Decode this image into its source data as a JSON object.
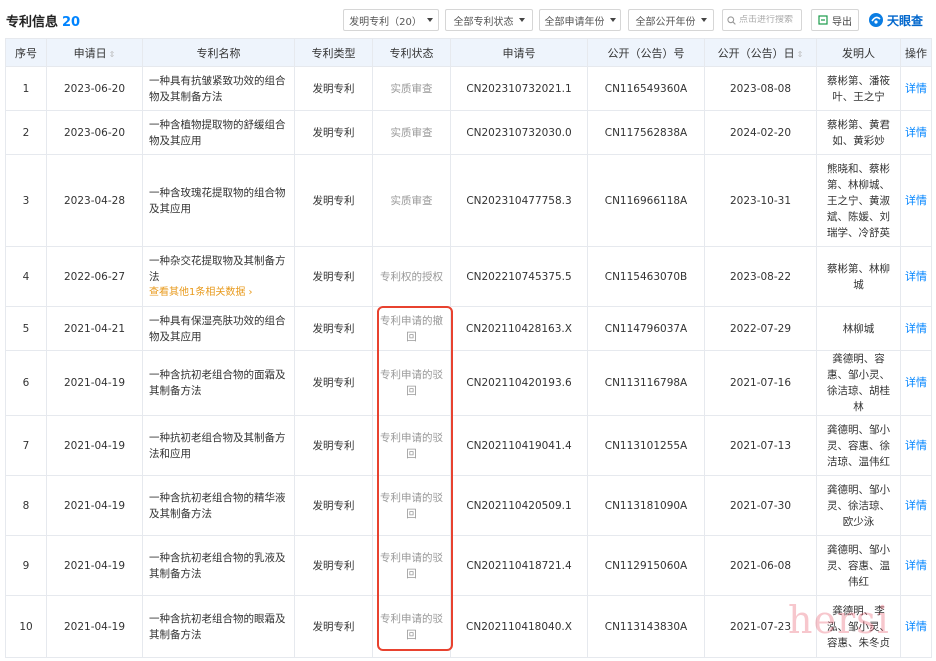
{
  "header": {
    "title": "专利信息",
    "count": "20",
    "filters": [
      {
        "label": "发明专利（20）"
      },
      {
        "label": "全部专利状态"
      },
      {
        "label": "全部申请年份"
      },
      {
        "label": "全部公开年份"
      }
    ],
    "search_placeholder": "点击进行搜索",
    "export_label": "导出",
    "logo_text": "天眼查"
  },
  "table": {
    "columns": [
      "序号",
      "申请日",
      "专利名称",
      "专利类型",
      "专利状态",
      "申请号",
      "公开（公告）号",
      "公开（公告）日",
      "发明人",
      "操作"
    ],
    "sortable": [
      "申请日",
      "公开（公告）日"
    ],
    "rows": [
      {
        "no": "1",
        "date": "2023-06-20",
        "name": "一种具有抗皱紧致功效的组合物及其制备方法",
        "more": "",
        "type": "发明专利",
        "status": "实质审查",
        "app_no": "CN202310732021.1",
        "pub_no": "CN116549360A",
        "pub_date": "2023-08-08",
        "inventors": "蔡彬第、潘筱叶、王之宁",
        "action": "详情",
        "h": 44
      },
      {
        "no": "2",
        "date": "2023-06-20",
        "name": "一种含植物提取物的舒缓组合物及其应用",
        "more": "",
        "type": "发明专利",
        "status": "实质审查",
        "app_no": "CN202310732030.0",
        "pub_no": "CN117562838A",
        "pub_date": "2024-02-20",
        "inventors": "蔡彬第、黄君如、黄彩妙",
        "action": "详情",
        "h": 44
      },
      {
        "no": "3",
        "date": "2023-04-28",
        "name": "一种含玫瑰花提取物的组合物及其应用",
        "more": "",
        "type": "发明专利",
        "status": "实质审查",
        "app_no": "CN202310477758.3",
        "pub_no": "CN116966118A",
        "pub_date": "2023-10-31",
        "inventors": "熊晓和、蔡彬第、林柳城、王之宁、黄淑斌、陈媛、刘瑞学、冷舒英",
        "action": "详情",
        "h": 92
      },
      {
        "no": "4",
        "date": "2022-06-27",
        "name": "一种杂交花提取物及其制备方法",
        "more": "查看其他1条相关数据 ›",
        "type": "发明专利",
        "status": "专利权的授权",
        "app_no": "CN202210745375.5",
        "pub_no": "CN115463070B",
        "pub_date": "2023-08-22",
        "inventors": "蔡彬第、林柳城",
        "action": "详情",
        "h": 60
      },
      {
        "no": "5",
        "date": "2021-04-21",
        "name": "一种具有保湿亮肤功效的组合物及其应用",
        "more": "",
        "type": "发明专利",
        "status": "专利申请的撤回",
        "app_no": "CN202110428163.X",
        "pub_no": "CN114796037A",
        "pub_date": "2022-07-29",
        "inventors": "林柳城",
        "action": "详情",
        "h": 44
      },
      {
        "no": "6",
        "date": "2021-04-19",
        "name": "一种含抗初老组合物的面霜及其制备方法",
        "more": "",
        "type": "发明专利",
        "status": "专利申请的驳回",
        "app_no": "CN202110420193.6",
        "pub_no": "CN113116798A",
        "pub_date": "2021-07-16",
        "inventors": "龚德明、容惠、邹小灵、徐洁琼、胡桂林",
        "action": "详情",
        "h": 62
      },
      {
        "no": "7",
        "date": "2021-04-19",
        "name": "一种抗初老组合物及其制备方法和应用",
        "more": "",
        "type": "发明专利",
        "status": "专利申请的驳回",
        "app_no": "CN202110419041.4",
        "pub_no": "CN113101255A",
        "pub_date": "2021-07-13",
        "inventors": "龚德明、邹小灵、容惠、徐洁琼、温伟红",
        "action": "详情",
        "h": 60
      },
      {
        "no": "8",
        "date": "2021-04-19",
        "name": "一种含抗初老组合物的精华液及其制备方法",
        "more": "",
        "type": "发明专利",
        "status": "专利申请的驳回",
        "app_no": "CN202110420509.1",
        "pub_no": "CN113181090A",
        "pub_date": "2021-07-30",
        "inventors": "龚德明、邹小灵、徐洁琼、欧少泳",
        "action": "详情",
        "h": 60
      },
      {
        "no": "9",
        "date": "2021-04-19",
        "name": "一种含抗初老组合物的乳液及其制备方法",
        "more": "",
        "type": "发明专利",
        "status": "专利申请的驳回",
        "app_no": "CN202110418721.4",
        "pub_no": "CN112915060A",
        "pub_date": "2021-06-08",
        "inventors": "龚德明、邹小灵、容惠、温伟红",
        "action": "详情",
        "h": 60
      },
      {
        "no": "10",
        "date": "2021-04-19",
        "name": "一种含抗初老组合物的眼霜及其制备方法",
        "more": "",
        "type": "发明专利",
        "status": "专利申请的驳回",
        "app_no": "CN202110418040.X",
        "pub_no": "CN113143830A",
        "pub_date": "2021-07-23",
        "inventors": "龚德明、李泓、邹小灵、容惠、朱冬贞",
        "action": "详情",
        "h": 62
      }
    ]
  },
  "watermark": "hersi",
  "colors": {
    "accent": "#0084ff",
    "more_link": "#e89a1c",
    "highlight": "#e8422f",
    "header_bg": "#eef4fc"
  }
}
